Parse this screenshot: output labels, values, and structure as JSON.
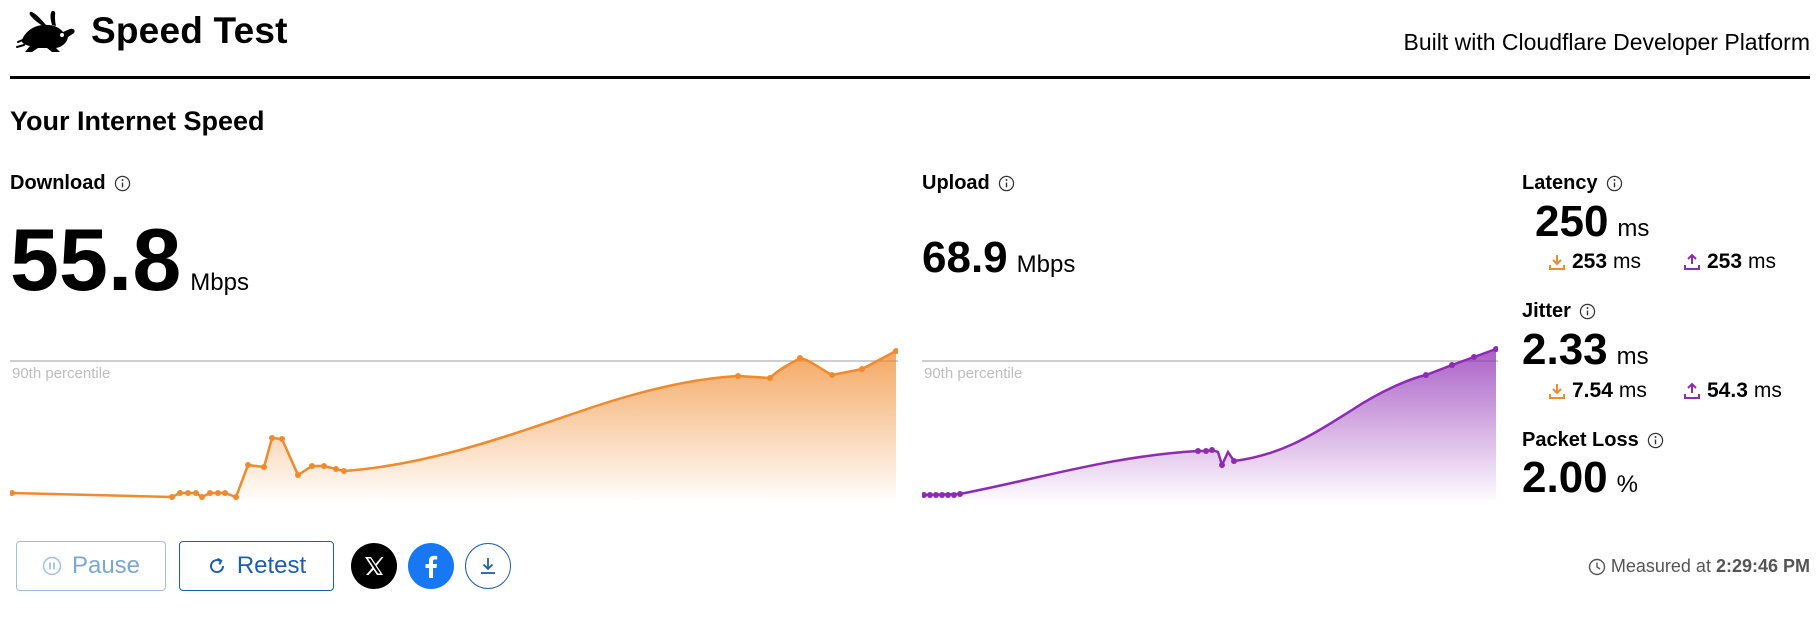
{
  "header": {
    "title": "Speed Test",
    "built_with": "Built with Cloudflare Developer Platform",
    "logo_icon": "rabbit-logo-icon"
  },
  "section_title": "Your Internet Speed",
  "download": {
    "label": "Download",
    "value": "55.8",
    "unit": "Mbps",
    "color": "#f08a2c"
  },
  "upload": {
    "label": "Upload",
    "value": "68.9",
    "unit": "Mbps",
    "color": "#8e2bb3"
  },
  "latency": {
    "label": "Latency",
    "value": "250",
    "unit": "ms",
    "down_value": "253",
    "up_value": "253",
    "sub_unit": "ms"
  },
  "jitter": {
    "label": "Jitter",
    "value": "2.33",
    "unit": "ms",
    "down_value": "7.54",
    "up_value": "54.3",
    "sub_unit": "ms"
  },
  "packet_loss": {
    "label": "Packet Loss",
    "value": "2.00",
    "unit": "%"
  },
  "percentile_label": "90th percentile",
  "buttons": {
    "pause": "Pause",
    "retest": "Retest"
  },
  "measured": {
    "prefix": "Measured at",
    "time": "2:29:46 PM"
  },
  "icons": {
    "info": "info-icon",
    "pause": "pause-circle-icon",
    "retest": "refresh-icon",
    "share_x": "x-logo-icon",
    "share_facebook": "facebook-logo-icon",
    "download": "download-icon",
    "clock": "clock-icon",
    "down_arrow": "download-arrow-icon",
    "up_arrow": "upload-arrow-icon"
  }
}
